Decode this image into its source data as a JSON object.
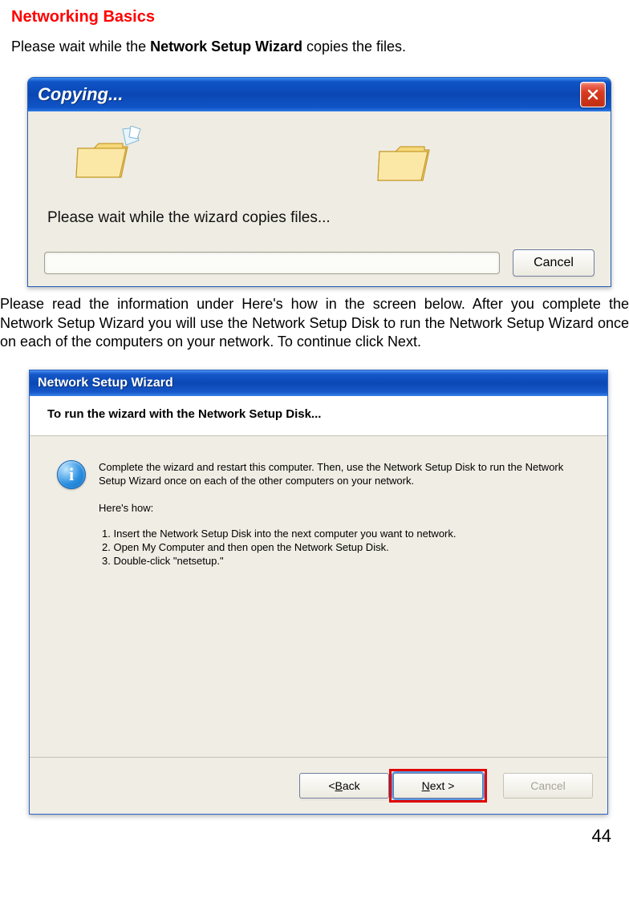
{
  "doc": {
    "title": "Networking Basics",
    "intro_prefix": "Please wait while the ",
    "intro_bold": "Network Setup Wizard",
    "intro_suffix": " copies the files.",
    "mid_parts": {
      "p1": "Please read the information under ",
      "b1": "Here's how",
      "p2": " in the screen below.  After you complete the ",
      "b2": "Network Setup Wizard",
      "p3": " you will use the ",
      "b3": "Network Setup Disk",
      "p4": " to run the ",
      "b4": "Network Setup Wizard",
      "p5": " once on each of the computers on your network. To continue click ",
      "b5": "Next.",
      "p6": ""
    },
    "page_number": "44"
  },
  "copy_dialog": {
    "title": "Copying...",
    "message": "Please wait while the wizard copies files...",
    "cancel": "Cancel"
  },
  "wizard_dialog": {
    "title": "Network Setup Wizard",
    "heading": "To run the wizard with the Network Setup Disk...",
    "info_char": "i",
    "para": "Complete the wizard and restart this computer. Then, use the Network Setup Disk to run the Network Setup Wizard once on each of the other computers on your network.",
    "how_label": "Here's how:",
    "steps": {
      "s1": "1.   Insert the Network Setup Disk into the next computer you want to network.",
      "s2": "2.   Open My Computer and then open the Network Setup Disk.",
      "s3": "3.   Double-click \"netsetup.\""
    },
    "buttons": {
      "back_pre": "< ",
      "back_u": "B",
      "back_post": "ack",
      "next_u": "N",
      "next_post": "ext >",
      "cancel": "Cancel"
    }
  }
}
